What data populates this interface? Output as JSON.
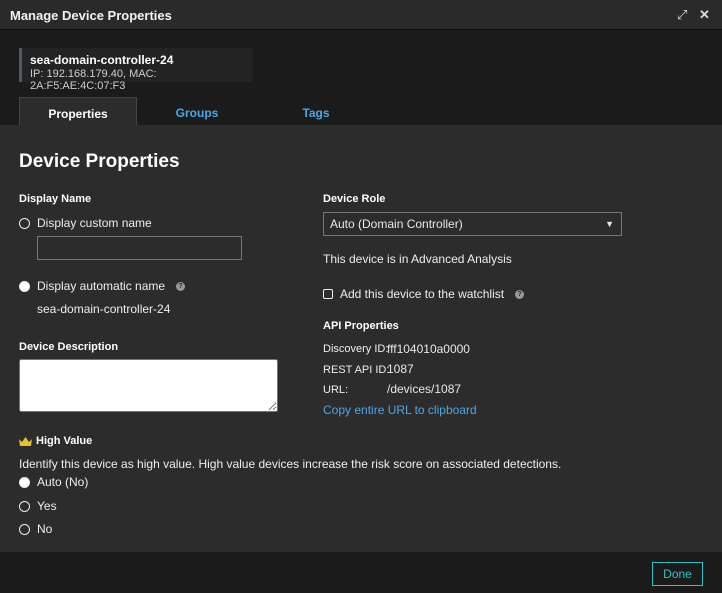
{
  "window": {
    "title": "Manage Device Properties",
    "expand_icon": "expand-arrows-icon",
    "close_icon": "close-x-icon"
  },
  "device": {
    "name": "sea-domain-controller-24",
    "info": "IP: 192.168.179.40, MAC: 2A:F5:AE:4C:07:F3"
  },
  "tabs": [
    {
      "label": "Properties",
      "active": true
    },
    {
      "label": "Groups"
    },
    {
      "label": "Tags"
    }
  ],
  "page_title": "Device Properties",
  "display_name": {
    "label": "Display Name",
    "custom_label": "Display custom name",
    "custom_value": "",
    "automatic_label": "Display automatic name",
    "automatic_value": "sea-domain-controller-24",
    "selected": "automatic"
  },
  "description": {
    "label": "Device Description",
    "value": ""
  },
  "role": {
    "label": "Device Role",
    "selected": "Auto (Domain Controller)",
    "analysis_text": "This device is in Advanced Analysis",
    "watchlist_label": "Add this device to the watchlist",
    "watchlist_checked": false
  },
  "api": {
    "label": "API Properties",
    "discovery_label": "Discovery ID:",
    "discovery_value": "fff104010a0000",
    "rest_label": "REST API ID:",
    "rest_value": "1087",
    "url_label": "URL:",
    "url_value": "/devices/1087",
    "copy_link": "Copy entire URL to clipboard"
  },
  "high_value": {
    "label": "High Value",
    "icon": "crown-icon",
    "icon_color": "#e8c22a",
    "description": "Identify this device as high value. High value devices increase the risk score on associated detections.",
    "options": [
      "Auto (No)",
      "Yes",
      "No"
    ],
    "selected": "Auto (No)"
  },
  "footer": {
    "done_label": "Done"
  },
  "colors": {
    "link": "#4aa8e8",
    "accent": "#2ec4c4"
  }
}
